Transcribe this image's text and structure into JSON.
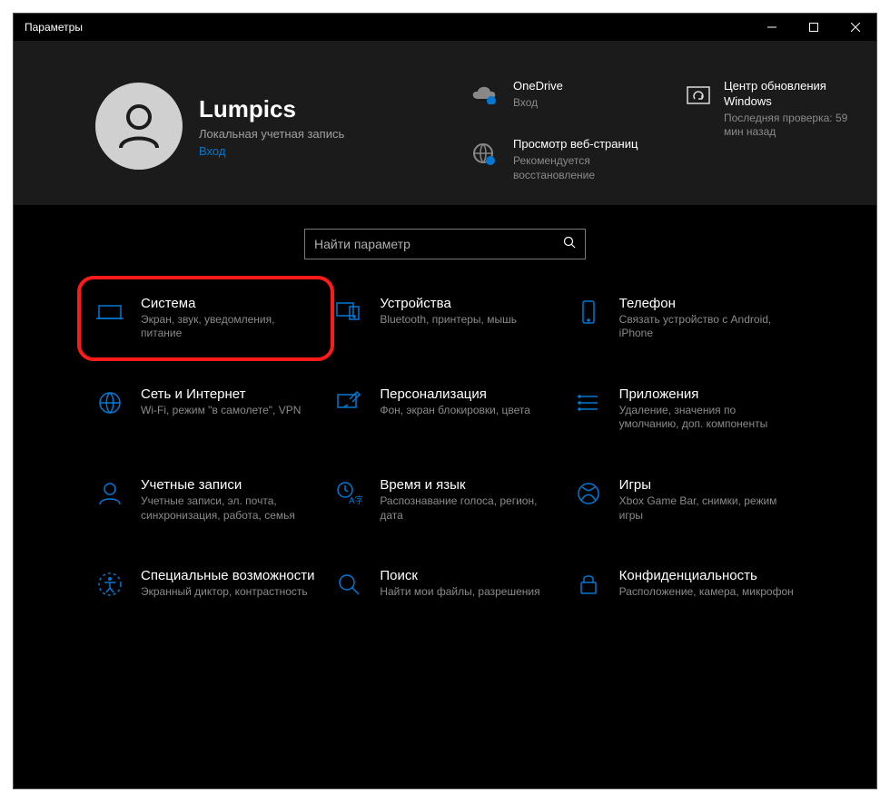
{
  "window": {
    "title": "Параметры"
  },
  "profile": {
    "name": "Lumpics",
    "account_type": "Локальная учетная запись",
    "login_link": "Вход"
  },
  "status": {
    "onedrive": {
      "title": "OneDrive",
      "subtitle": "Вход"
    },
    "browser": {
      "title": "Просмотр веб-страниц",
      "subtitle": "Рекомендуется восстановление"
    }
  },
  "update": {
    "title": "Центр обновления Windows",
    "subtitle": "Последняя проверка: 59 мин назад"
  },
  "search": {
    "placeholder": "Найти параметр"
  },
  "tiles": [
    {
      "title": "Система",
      "desc": "Экран, звук, уведомления, питание"
    },
    {
      "title": "Устройства",
      "desc": "Bluetooth, принтеры, мышь"
    },
    {
      "title": "Телефон",
      "desc": "Связать устройство с Android, iPhone"
    },
    {
      "title": "Сеть и Интернет",
      "desc": "Wi-Fi, режим \"в самолете\", VPN"
    },
    {
      "title": "Персонализация",
      "desc": "Фон, экран блокировки, цвета"
    },
    {
      "title": "Приложения",
      "desc": "Удаление, значения по умолчанию, доп. компоненты"
    },
    {
      "title": "Учетные записи",
      "desc": "Учетные записи, эл. почта, синхронизация, работа, семья"
    },
    {
      "title": "Время и язык",
      "desc": "Распознавание голоса, регион, дата"
    },
    {
      "title": "Игры",
      "desc": "Xbox Game Bar, снимки, режим игры"
    },
    {
      "title": "Специальные возможности",
      "desc": "Экранный диктор, контрастность"
    },
    {
      "title": "Поиск",
      "desc": "Найти мои файлы, разрешения"
    },
    {
      "title": "Конфиденциальность",
      "desc": "Расположение, камера, микрофон"
    }
  ]
}
